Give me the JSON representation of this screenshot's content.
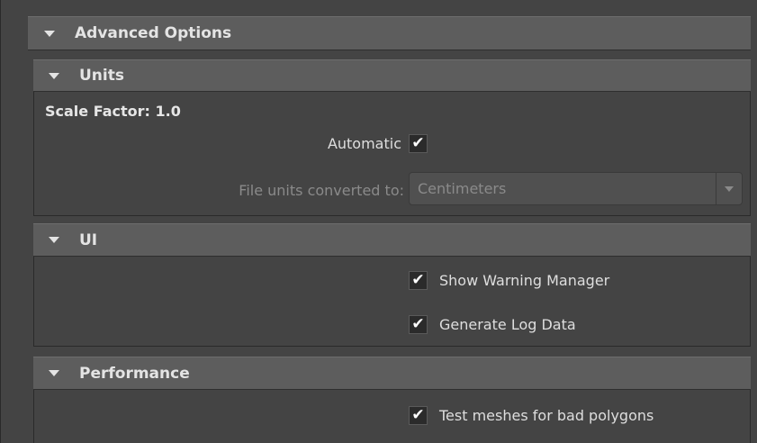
{
  "advanced_options": {
    "title": "Advanced Options"
  },
  "units": {
    "title": "Units",
    "scale_factor_label": "Scale Factor: 1.0",
    "automatic_label": "Automatic",
    "automatic_checked": true,
    "file_units_label": "File units converted to:",
    "file_units_value": "Centimeters"
  },
  "ui": {
    "title": "UI",
    "show_warning_label": "Show Warning Manager",
    "show_warning_checked": true,
    "generate_log_label": "Generate Log Data",
    "generate_log_checked": true
  },
  "performance": {
    "title": "Performance",
    "test_meshes_label": "Test meshes for bad polygons",
    "test_meshes_checked": true
  },
  "icons": {
    "expand": "triangle-down-icon",
    "check": "checkmark-icon",
    "dropdown": "chevron-down-icon"
  }
}
